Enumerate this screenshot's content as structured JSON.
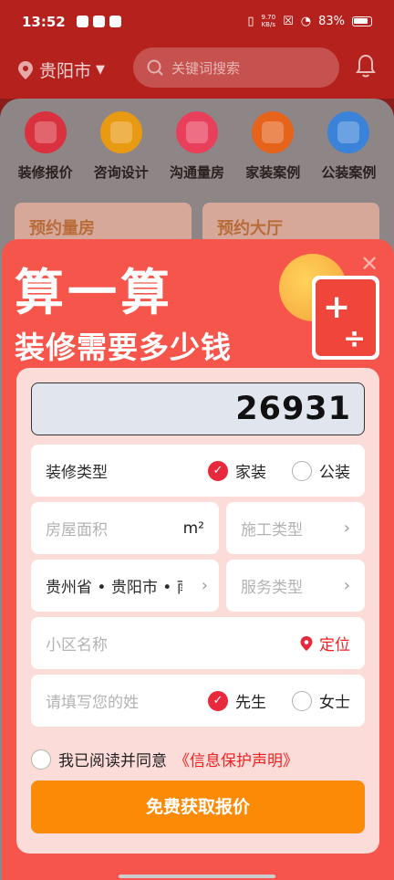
{
  "status_bar": {
    "time": "13:52",
    "net_speed_top": "9.70",
    "net_speed_bottom": "KB/s",
    "battery_pct": "83%"
  },
  "header": {
    "city": "贵阳市",
    "search_placeholder": "关键词搜索"
  },
  "categories": [
    {
      "label": "装修报价",
      "color": "#d9313d"
    },
    {
      "label": "咨询设计",
      "color": "#e99a13"
    },
    {
      "label": "沟通量房",
      "color": "#e83f5a"
    },
    {
      "label": "家装案例",
      "color": "#e5631b"
    },
    {
      "label": "公装案例",
      "color": "#3b82d9"
    }
  ],
  "promos": [
    "预约量房",
    "预约大厅"
  ],
  "modal": {
    "title_line1": "算一算",
    "title_line2": "装修需要多少钱",
    "total": "26931",
    "decoration_type": {
      "label": "装修类型",
      "options": [
        "家装",
        "公装"
      ],
      "selected": "家装"
    },
    "area": {
      "placeholder": "房屋面积",
      "unit": "m²"
    },
    "construction_type": {
      "placeholder": "施工类型"
    },
    "region": {
      "value": "贵州省 • 贵阳市 • 南"
    },
    "service_type": {
      "placeholder": "服务类型"
    },
    "community": {
      "placeholder": "小区名称",
      "locate_label": "定位"
    },
    "surname": {
      "placeholder": "请填写您的姓",
      "options": [
        "先生",
        "女士"
      ],
      "selected": "先生"
    },
    "agreement": {
      "text": "我已阅读并同意",
      "link": "《信息保护声明》",
      "checked": false
    },
    "submit_label": "免费获取报价"
  },
  "colors": {
    "brand_red": "#f5554a",
    "accent_red": "#e7293b",
    "submit_orange": "#fb8a06"
  }
}
